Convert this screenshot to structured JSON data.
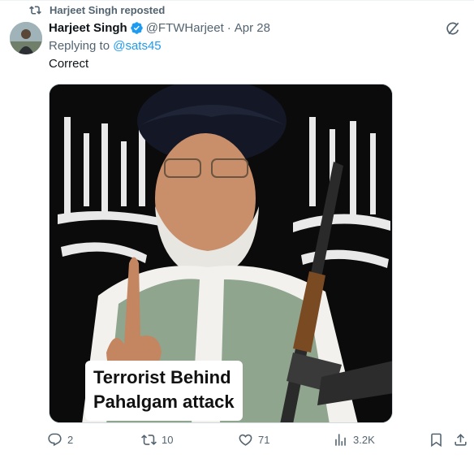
{
  "repost": {
    "label": "Harjeet Singh reposted"
  },
  "post": {
    "display_name": "Harjeet Singh",
    "handle": "@FTWHarjeet",
    "separator": "·",
    "date": "Apr 28",
    "replying_prefix": "Replying to ",
    "replying_to": "@sats45",
    "text": "Correct"
  },
  "media": {
    "caption_line1": "Terrorist Behind",
    "caption_line2": "Pahalgam attack"
  },
  "actions": {
    "replies": "2",
    "reposts": "10",
    "likes": "71",
    "views": "3.2K"
  },
  "colors": {
    "accent": "#1d9bf0",
    "secondary_text": "#536471",
    "verified": "#1d9bf0"
  },
  "icons": [
    "repost-icon",
    "verified-badge-icon",
    "grok-icon",
    "reply-icon",
    "retweet-icon",
    "like-icon",
    "views-icon",
    "bookmark-icon",
    "share-icon"
  ]
}
